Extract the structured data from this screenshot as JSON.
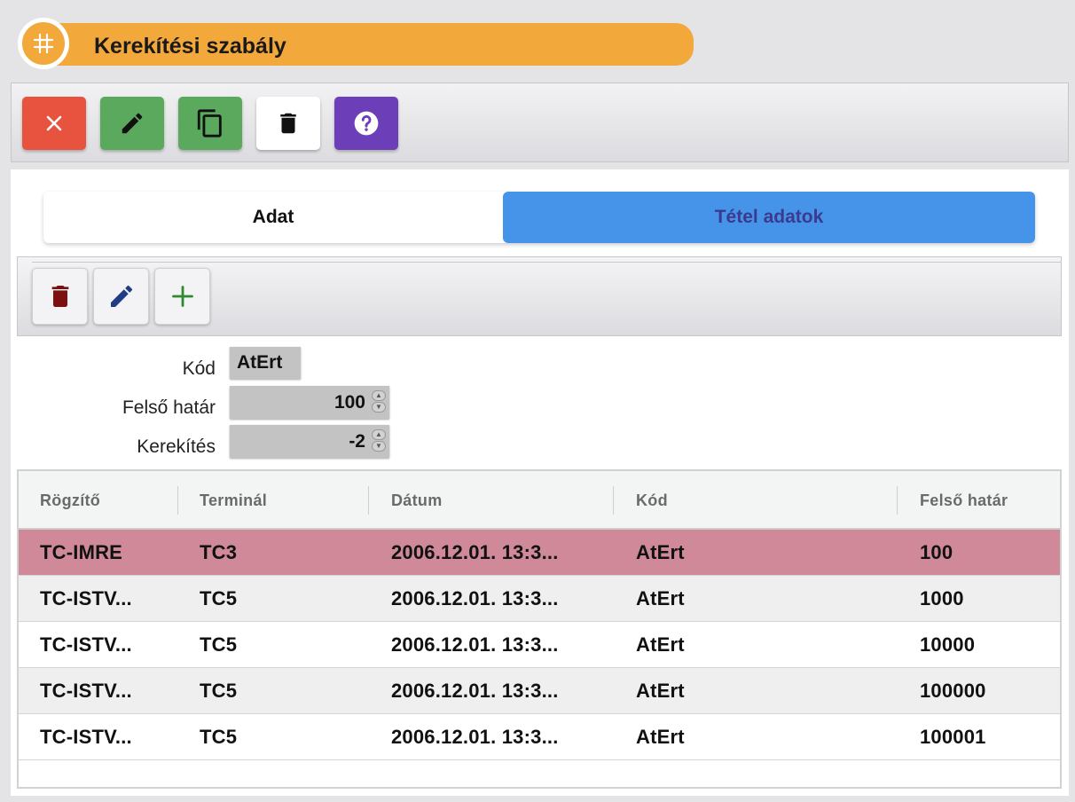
{
  "title": "Kerekítési szabály",
  "tabs": [
    {
      "label": "Adat"
    },
    {
      "label": "Tétel adatok"
    }
  ],
  "form": {
    "kod_label": "Kód",
    "kod_value": "AtErt",
    "felso_label": "Felső határ",
    "felso_value": "100",
    "kerekites_label": "Kerekítés",
    "kerekites_value": "-2"
  },
  "grid": {
    "headers": [
      "Rögzítő",
      "Terminál",
      "Dátum",
      "Kód",
      "Felső határ"
    ],
    "rows": [
      {
        "rogzito": "TC-IMRE",
        "terminal": "TC3",
        "datum": "2006.12.01. 13:3...",
        "kod": "AtErt",
        "felso": "100"
      },
      {
        "rogzito": "TC-ISTV...",
        "terminal": "TC5",
        "datum": "2006.12.01. 13:3...",
        "kod": "AtErt",
        "felso": "1000"
      },
      {
        "rogzito": "TC-ISTV...",
        "terminal": "TC5",
        "datum": "2006.12.01. 13:3...",
        "kod": "AtErt",
        "felso": "10000"
      },
      {
        "rogzito": "TC-ISTV...",
        "terminal": "TC5",
        "datum": "2006.12.01. 13:3...",
        "kod": "AtErt",
        "felso": "100000"
      },
      {
        "rogzito": "TC-ISTV...",
        "terminal": "TC5",
        "datum": "2006.12.01. 13:3...",
        "kod": "AtErt",
        "felso": "100001"
      }
    ]
  },
  "colors": {
    "title_accent": "#f2a83b",
    "close_button": "#e8533f",
    "edit_button": "#5aa95c",
    "copy_button": "#5aa95c",
    "help_button": "#6c3fb9",
    "active_tab": "#4594ea",
    "selected_row": "#cf8998"
  },
  "icons": {
    "title": "hash-icon",
    "close": "close-icon",
    "edit": "pencil-icon",
    "copy": "copy-icon",
    "delete": "trash-icon",
    "help": "help-icon",
    "sub_delete": "trash-icon",
    "sub_edit": "pencil-icon",
    "sub_add": "plus-icon"
  }
}
